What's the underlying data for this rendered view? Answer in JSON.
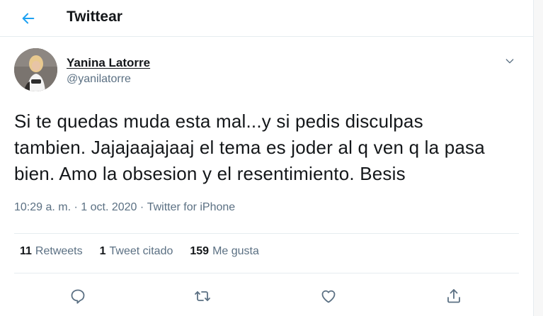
{
  "header": {
    "title": "Twittear",
    "back_icon": "arrow-left-icon",
    "accent_color": "#1da1f2"
  },
  "author": {
    "name": "Yanina Latorre",
    "handle": "@yanilatorre"
  },
  "tweet": {
    "text": "Si te quedas muda esta mal...y si pedis disculpas\ntambien. Jajajaajajaaj el tema es joder al q ven q la pasa\nbien. Amo la obsesion y el resentimiento. Besis"
  },
  "meta": {
    "time": "10:29 a. m.",
    "separator": "·",
    "date": "1 oct. 2020",
    "source": "Twitter for iPhone"
  },
  "stats": [
    {
      "count": "11",
      "label": "Retweets"
    },
    {
      "count": "1",
      "label": "Tweet citado"
    },
    {
      "count": "159",
      "label": "Me gusta"
    }
  ],
  "actions": [
    "reply-icon",
    "retweet-icon",
    "like-icon",
    "share-icon"
  ],
  "colors": {
    "text": "#14171a",
    "muted": "#5b7083",
    "border": "#e6ecf0"
  }
}
